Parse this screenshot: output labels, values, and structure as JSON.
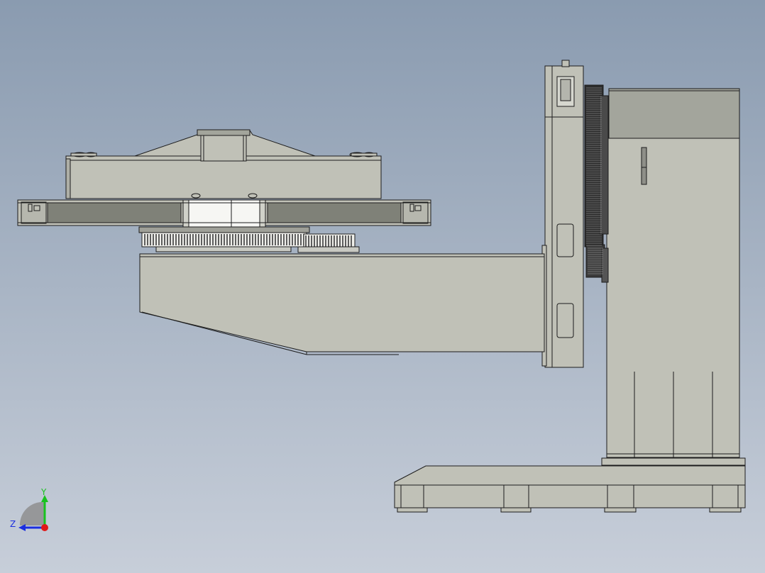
{
  "view": {
    "background_top": "#8a9bb0",
    "background_bottom": "#c7ced9",
    "part_fill": "#c0c1b7",
    "part_shadow": "#a3a59c",
    "edge_color": "#1c1c1c",
    "highlight_fill": "#f4f4f2",
    "gear_dark": "#3a3a3a"
  },
  "triad": {
    "y_label": "Y",
    "z_label": "Z",
    "y_color": "#18c21e",
    "z_color": "#1b2ee0",
    "origin_color": "#e01818"
  }
}
